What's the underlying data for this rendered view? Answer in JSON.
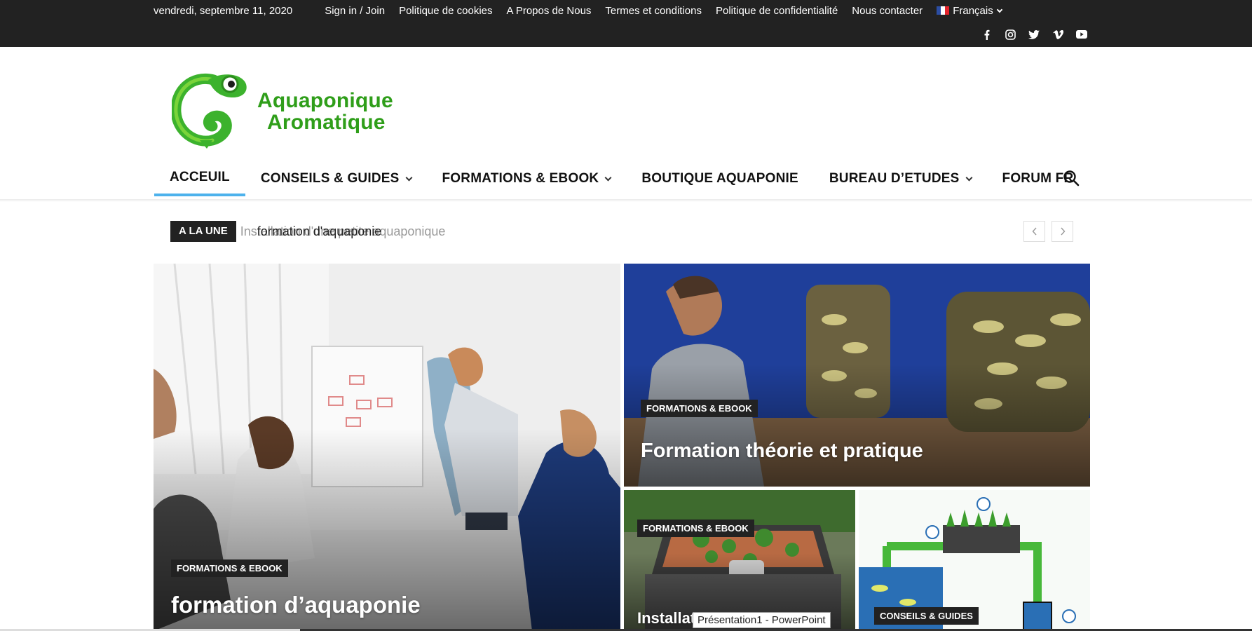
{
  "topbar": {
    "date": "vendredi, septembre 11, 2020",
    "links": [
      "Sign in / Join",
      "Politique de cookies",
      "A Propos de Nous",
      "Termes et conditions",
      "Politique de confidentialité",
      "Nous contacter"
    ],
    "language": "Français",
    "social_icons": [
      "facebook-icon",
      "instagram-icon",
      "twitter-icon",
      "vimeo-icon",
      "youtube-icon"
    ]
  },
  "logo": {
    "line1": "Aquaponique",
    "line2": "Aromatique",
    "color": "#2f9e1a"
  },
  "nav": {
    "items": [
      {
        "label": "ACCEUIL",
        "dropdown": false,
        "active": true
      },
      {
        "label": "CONSEILS & GUIDES",
        "dropdown": true
      },
      {
        "label": "FORMATIONS & EBOOK",
        "dropdown": true
      },
      {
        "label": "BOUTIQUE AQUAPONIE",
        "dropdown": false
      },
      {
        "label": "BUREAU D’ETUDES",
        "dropdown": true
      },
      {
        "label": "FORUM FR",
        "dropdown": false
      }
    ],
    "accent": "#4db2ec"
  },
  "ticker": {
    "label": "A LA UNE",
    "text_faded": "Installation d'une petite aquaponique",
    "text": "formation d'aquaponie"
  },
  "tiles": [
    {
      "category": "FORMATIONS & EBOOK",
      "title": "formation d’aquaponie"
    },
    {
      "category": "FORMATIONS & EBOOK",
      "title": "Formation théorie et pratique"
    },
    {
      "category": "FORMATIONS & EBOOK",
      "title": "Installati"
    },
    {
      "category": "CONSEILS & GUIDES",
      "title": ""
    }
  ],
  "tooltip": "Présentation1 - PowerPoint"
}
